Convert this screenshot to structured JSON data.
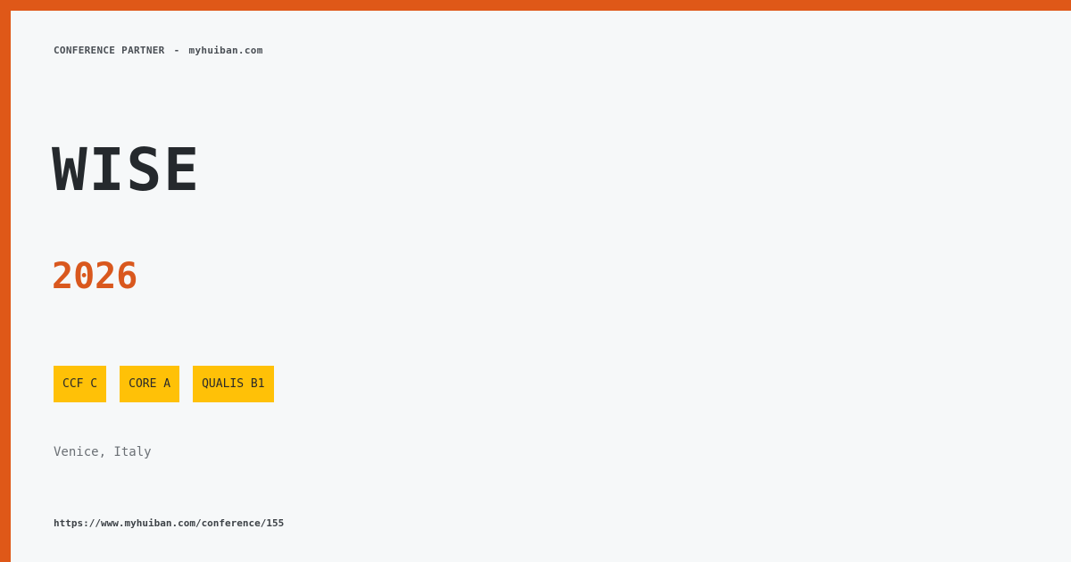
{
  "header": {
    "label": "CONFERENCE PARTNER",
    "separator": "-",
    "site": "myhuiban.com"
  },
  "conference": {
    "name": "WISE",
    "year": "2026",
    "location": "Venice, Italy",
    "url": "https://www.myhuiban.com/conference/155"
  },
  "badges": [
    {
      "label": "CCF C"
    },
    {
      "label": "CORE A"
    },
    {
      "label": "QUALIS B1"
    }
  ],
  "colors": {
    "accent": "#df5818",
    "year": "#d9581e",
    "badge": "#ffc107",
    "background": "#f6f8f9"
  }
}
